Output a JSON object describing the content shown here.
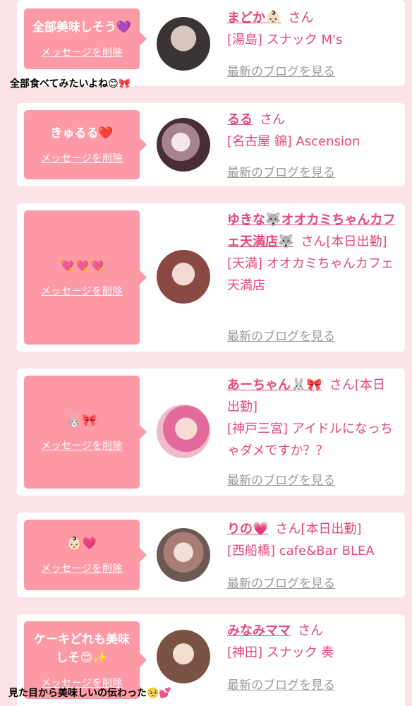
{
  "delete_label": "メッセージを削除",
  "blog_label": "最新のブログを見る",
  "cards": [
    {
      "message": "全部美味しそう💜",
      "name": "まどか👶🏻",
      "suffix": "さん",
      "shop": "[湯島] スナック M's",
      "caption": "全部食べてみたいよね😊🎀"
    },
    {
      "message": "きゅるる❤️",
      "name": "るる",
      "suffix": "さん",
      "shop": "[名古屋 錦] Ascension"
    },
    {
      "message": "💘💘💘",
      "name": "ゆきな🐺オオカミちゃんカフェ天満店🐺",
      "suffix": "さん[本日出勤]",
      "shop": "[天満] オオカミちゃんカフェ天満店"
    },
    {
      "message": "🐰🎀",
      "name": "あーちゃん🐰🎀",
      "suffix": "さん[本日出勤]",
      "shop": "[神戸三宮] アイドルになっちゃダメですか？？"
    },
    {
      "message": "👶🏻💗",
      "name": "りの💗",
      "suffix": "さん[本日出勤]",
      "shop": "[西船橋] cafe&Bar BLEA"
    },
    {
      "message": "ケーキどれも美味しそ😍✨",
      "name": "みなみママ",
      "suffix": "さん",
      "shop": "[神田] スナック 奏",
      "caption": "見た目から美味しいの伝わった🥺💕"
    }
  ],
  "colors": {
    "background": "#fbe3e8",
    "bubble": "#fe99a6",
    "accent": "#e5487a",
    "muted": "#9a9a9a"
  }
}
